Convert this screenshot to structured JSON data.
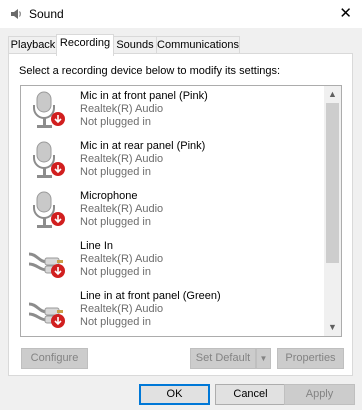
{
  "window": {
    "title": "Sound",
    "close_glyph": "✕"
  },
  "tabs": [
    {
      "label": "Playback"
    },
    {
      "label": "Recording"
    },
    {
      "label": "Sounds"
    },
    {
      "label": "Communications"
    }
  ],
  "instruction": "Select a recording device below to modify its settings:",
  "devices": [
    {
      "name": "Mic in at front panel (Pink)",
      "driver": "Realtek(R) Audio",
      "status": "Not plugged in",
      "icon": "microphone-icon"
    },
    {
      "name": "Mic in at rear panel (Pink)",
      "driver": "Realtek(R) Audio",
      "status": "Not plugged in",
      "icon": "microphone-icon"
    },
    {
      "name": "Microphone",
      "driver": "Realtek(R) Audio",
      "status": "Not plugged in",
      "icon": "microphone-icon"
    },
    {
      "name": "Line In",
      "driver": "Realtek(R) Audio",
      "status": "Not plugged in",
      "icon": "line-in-cable-icon"
    },
    {
      "name": "Line in at front panel (Green)",
      "driver": "Realtek(R) Audio",
      "status": "Not plugged in",
      "icon": "line-in-cable-icon"
    }
  ],
  "buttons": {
    "configure": "Configure",
    "set_default": "Set Default",
    "properties": "Properties",
    "ok": "OK",
    "cancel": "Cancel",
    "apply": "Apply"
  },
  "colors": {
    "status_red": "#d11f1f",
    "ok_border": "#0078d7"
  }
}
